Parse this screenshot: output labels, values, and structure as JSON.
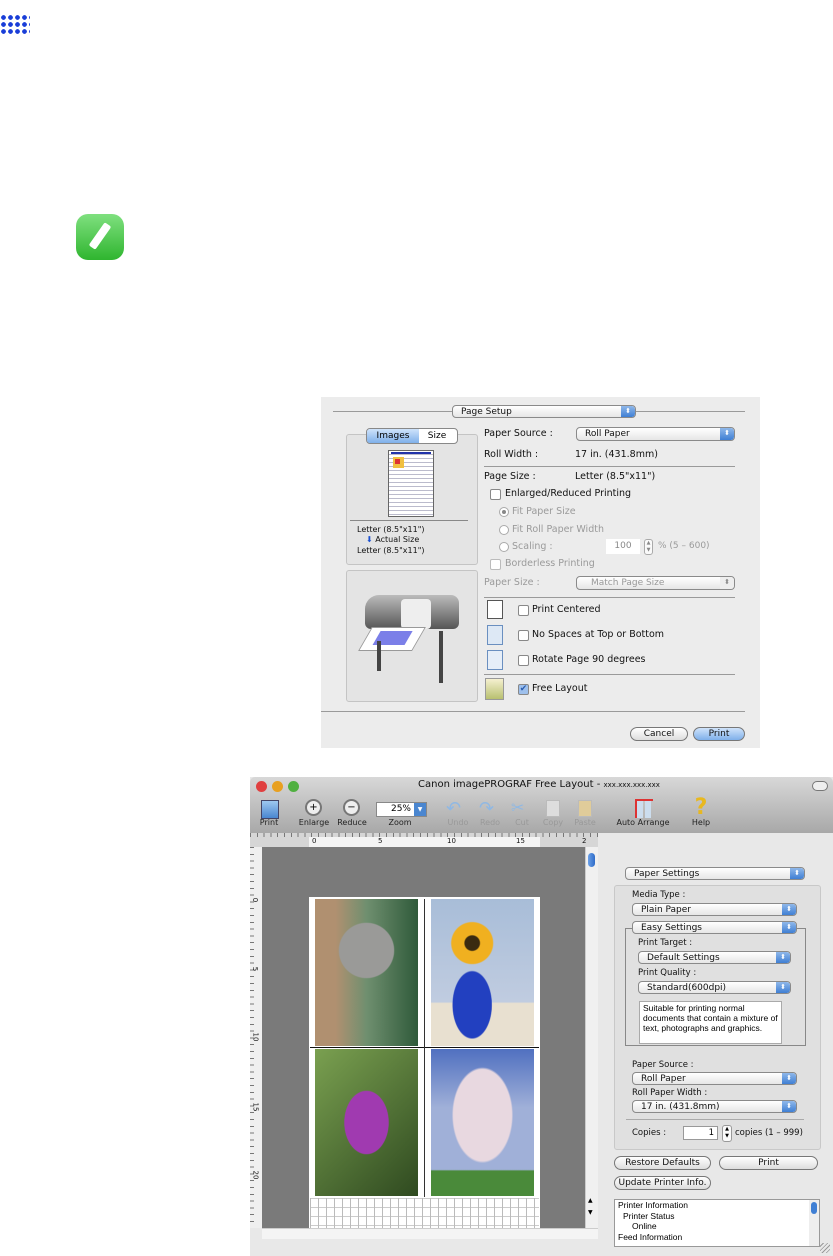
{
  "page_setup": {
    "popup": "Page Setup",
    "tabs": [
      "Images",
      "Size"
    ],
    "preview_from": "Letter (8.5\"x11\")",
    "preview_arrow_label": "Actual Size",
    "preview_to": "Letter (8.5\"x11\")",
    "paper_source_label": "Paper Source :",
    "paper_source_value": "Roll Paper",
    "roll_width_label": "Roll Width :",
    "roll_width_value": "17 in. (431.8mm)",
    "page_size_label": "Page Size :",
    "page_size_value": "Letter (8.5\"x11\")",
    "enlarged_reduced": "Enlarged/Reduced Printing",
    "fit_paper_size": "Fit Paper Size",
    "fit_roll_width": "Fit Roll Paper Width",
    "scaling_label": "Scaling :",
    "scaling_value": "100",
    "scaling_range": "% (5 – 600)",
    "borderless": "Borderless Printing",
    "paper_size_label": "Paper Size :",
    "paper_size_value": "Match Page Size",
    "print_centered": "Print Centered",
    "no_spaces": "No Spaces at Top or Bottom",
    "rotate": "Rotate Page 90 degrees",
    "free_layout": "Free Layout",
    "cancel": "Cancel",
    "print": "Print"
  },
  "free_layout": {
    "title": "Canon imagePROGRAF Free Layout - ",
    "title_host": "xxx.xxx.xxx.xxx",
    "toolbar": {
      "print": "Print",
      "enlarge": "Enlarge",
      "reduce": "Reduce",
      "zoom": "Zoom",
      "zoom_value": "25%",
      "undo": "Undo",
      "redo": "Redo",
      "cut": "Cut",
      "copy": "Copy",
      "paste": "Paste",
      "auto_arrange": "Auto Arrange",
      "help": "Help"
    },
    "ruler_h": [
      "0",
      "5",
      "10",
      "15",
      "2"
    ],
    "ruler_v": [
      "0",
      "5",
      "10",
      "15",
      "20"
    ],
    "panel": {
      "settings_popup": "Paper Settings",
      "media_type_label": "Media Type :",
      "media_type": "Plain Paper",
      "easy_settings": "Easy Settings",
      "print_target_label": "Print Target :",
      "print_target": "Default Settings",
      "print_quality_label": "Print Quality :",
      "print_quality": "Standard(600dpi)",
      "description": "Suitable for printing normal documents that contain a mixture of text, photographs and graphics.",
      "paper_source_label": "Paper Source :",
      "paper_source": "Roll Paper",
      "roll_width_label": "Roll Paper Width :",
      "roll_width": "17 in. (431.8mm)",
      "copies_label": "Copies :",
      "copies_value": "1",
      "copies_range": "copies (1 – 999)",
      "restore_defaults": "Restore Defaults",
      "print": "Print",
      "update_info": "Update Printer Info.",
      "info": [
        "Printer Information",
        "Printer Status",
        "Online",
        "Feed Information"
      ]
    }
  },
  "colors": {
    "accent": "#3f7fd4",
    "note_green": "#3cc43c",
    "grid_icon": "#1a3ed8"
  }
}
